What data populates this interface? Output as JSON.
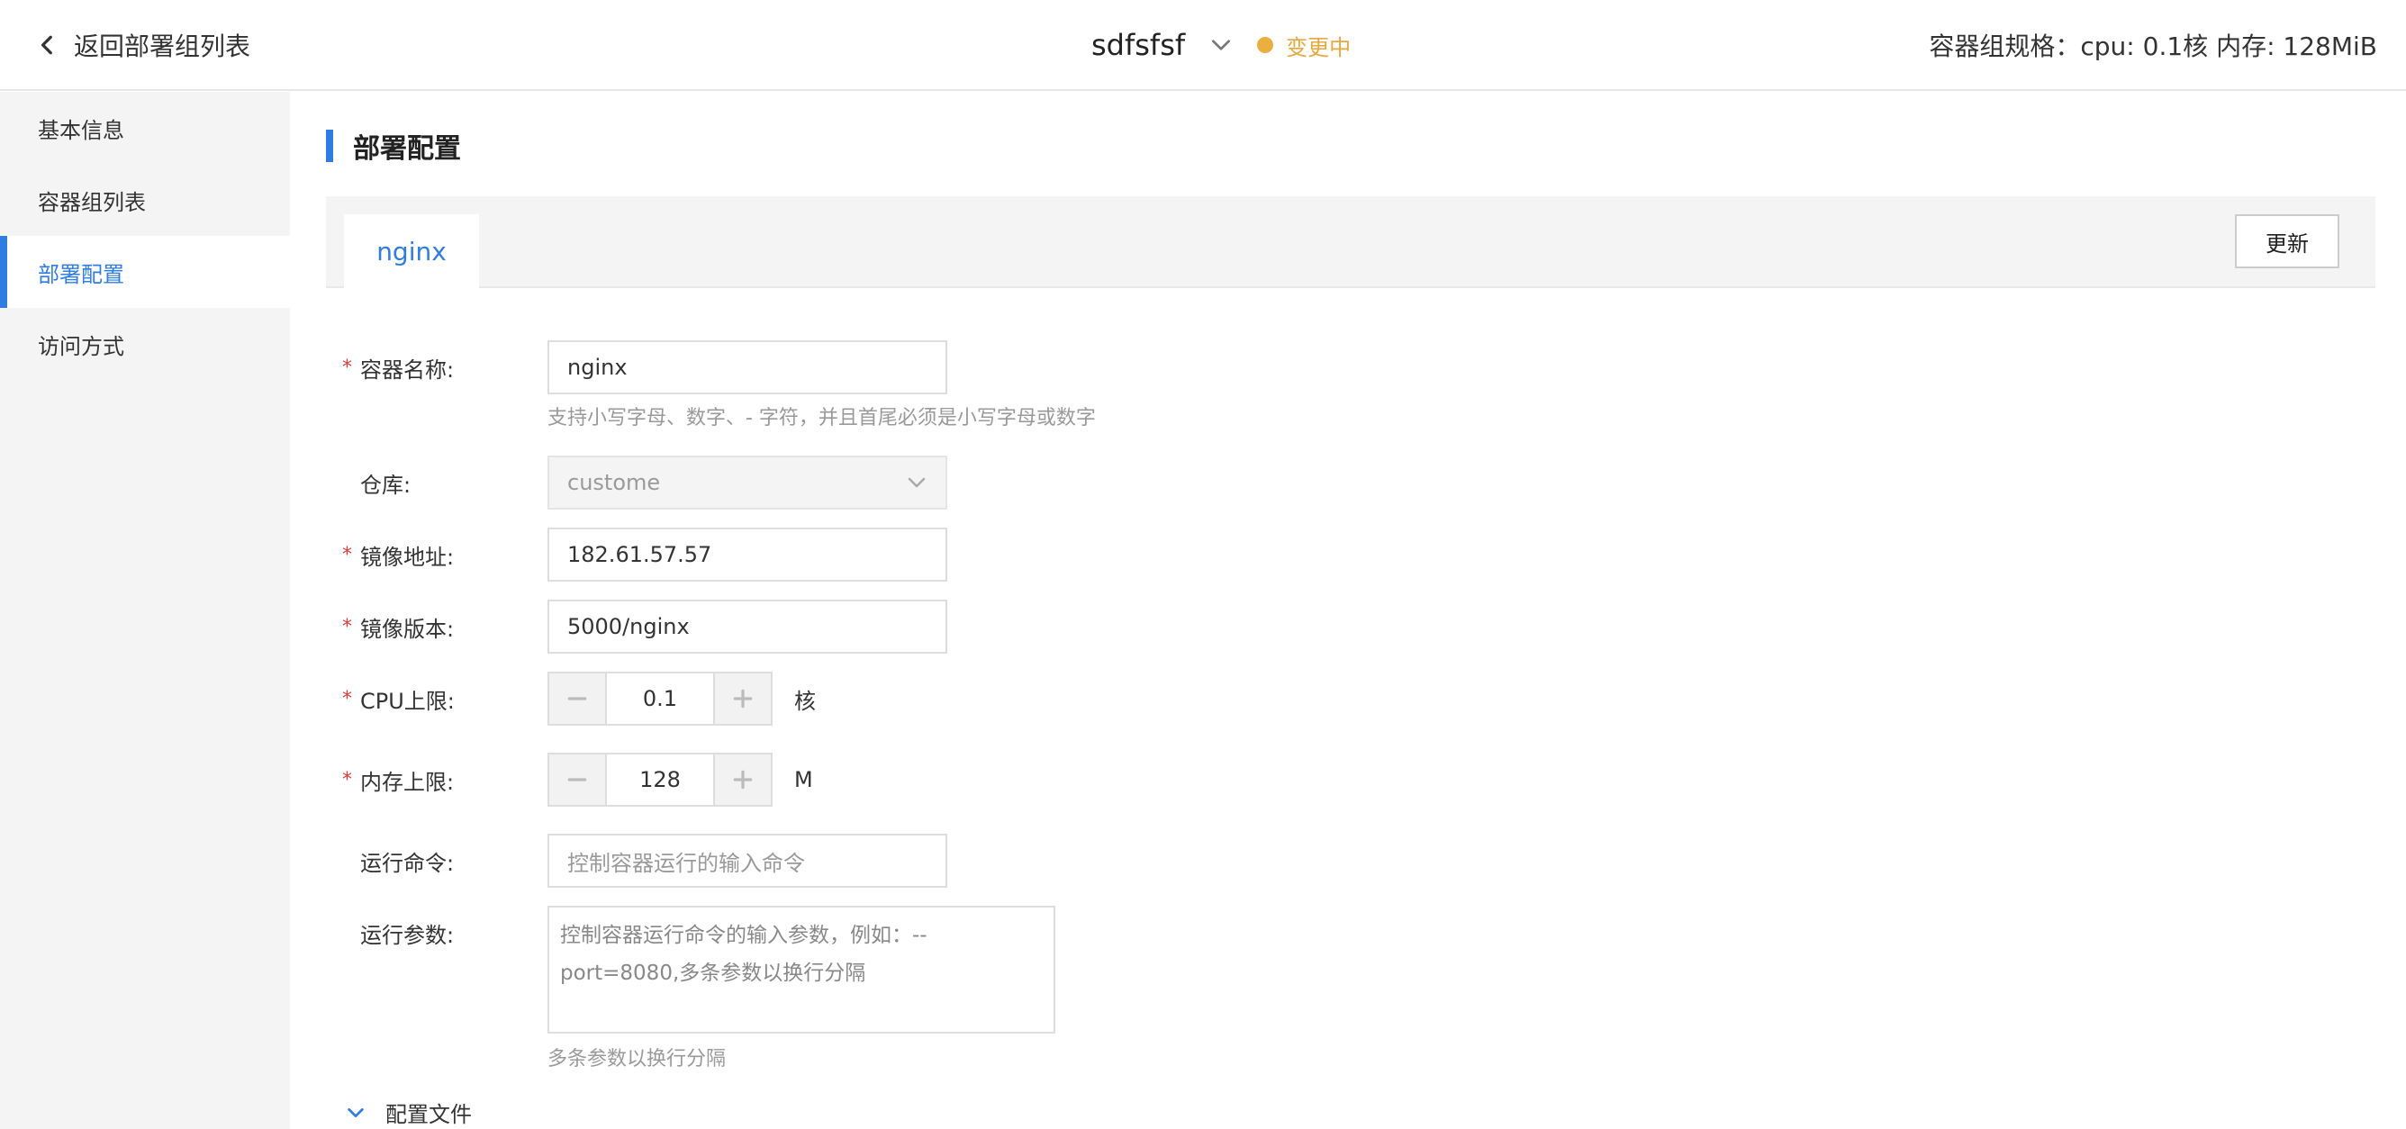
{
  "header": {
    "back_label": "返回部署组列表",
    "title": "sdfsfsf",
    "status": "变更中",
    "spec": "容器组规格：cpu: 0.1核 内存: 128MiB",
    "status_color": "#eab03f"
  },
  "sidebar": {
    "items": [
      {
        "label": "基本信息"
      },
      {
        "label": "容器组列表"
      },
      {
        "label": "部署配置",
        "active": true
      },
      {
        "label": "访问方式"
      }
    ]
  },
  "main": {
    "section_title": "部署配置",
    "tabs": [
      {
        "label": "nginx",
        "active": true
      }
    ],
    "update_label": "更新",
    "form": {
      "container_name": {
        "label": "容器名称:",
        "value": "nginx",
        "hint": "支持小写字母、数字、- 字符，并且首尾必须是小写字母或数字"
      },
      "repo": {
        "label": "仓库:",
        "value": "custome"
      },
      "image_address": {
        "label": "镜像地址:",
        "value": "182.61.57.57"
      },
      "image_version": {
        "label": "镜像版本:",
        "value": "5000/nginx"
      },
      "cpu": {
        "label": "CPU上限:",
        "value": "0.1",
        "unit": "核"
      },
      "memory": {
        "label": "内存上限:",
        "value": "128",
        "unit": "M"
      },
      "command": {
        "label": "运行命令:",
        "placeholder": "控制容器运行的输入命令"
      },
      "args": {
        "label": "运行参数:",
        "placeholder": "控制容器运行命令的输入参数，例如：--port=8080,多条参数以换行分隔",
        "hint": "多条参数以换行分隔"
      },
      "config_file": {
        "label": "配置文件"
      }
    }
  },
  "colors": {
    "accent": "#2f7de1",
    "required": "#e53935"
  }
}
